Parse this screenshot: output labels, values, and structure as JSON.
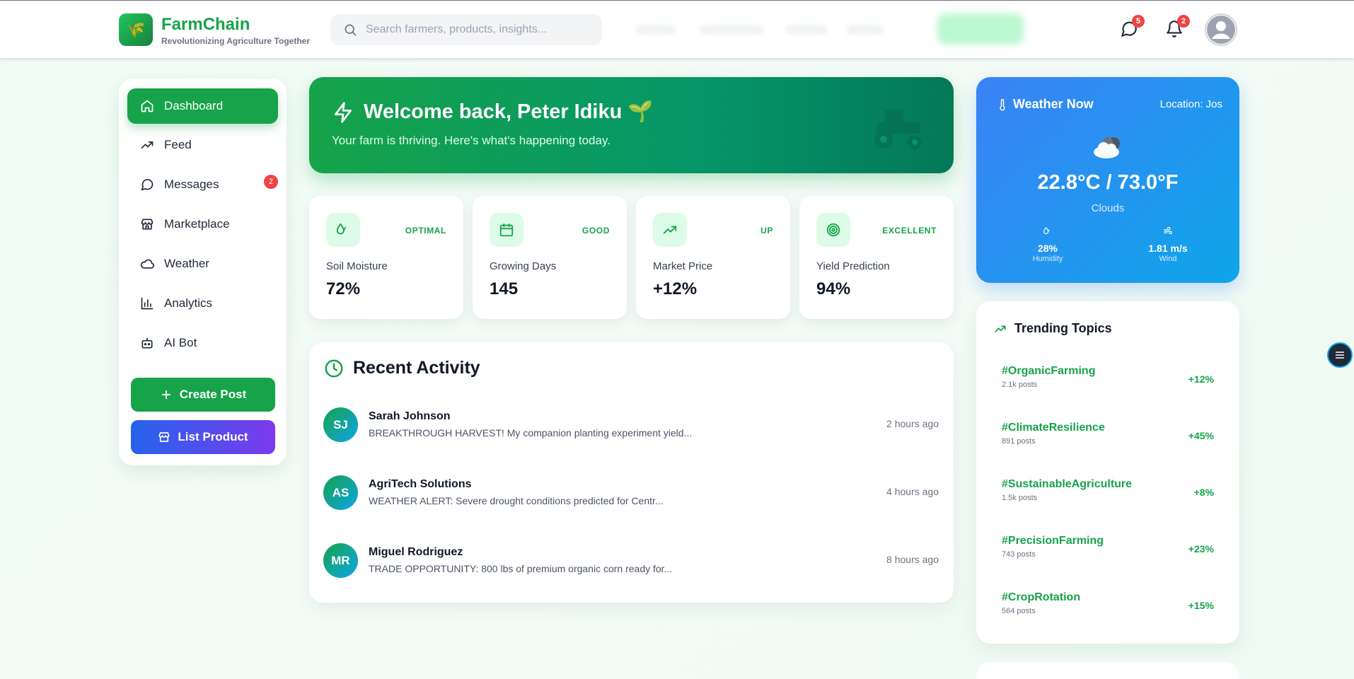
{
  "header": {
    "brand_name": "FarmChain",
    "brand_tagline": "Revolutionizing Agriculture Together",
    "search_placeholder": "Search farmers, products, insights...",
    "messages_badge": "5",
    "notifications_badge": "2"
  },
  "sidebar": {
    "items": [
      {
        "label": "Dashboard",
        "icon": "home-icon",
        "active": true
      },
      {
        "label": "Feed",
        "icon": "trending-up-icon"
      },
      {
        "label": "Messages",
        "icon": "message-circle-icon",
        "badge": "2"
      },
      {
        "label": "Marketplace",
        "icon": "store-icon"
      },
      {
        "label": "Weather",
        "icon": "cloud-icon"
      },
      {
        "label": "Analytics",
        "icon": "bar-chart-icon"
      },
      {
        "label": "AI Bot",
        "icon": "bot-icon"
      }
    ],
    "create_post_label": "Create Post",
    "list_product_label": "List Product"
  },
  "welcome": {
    "title": "Welcome back, Peter Idiku 🌱",
    "subtitle": "Your farm is thriving. Here's what's happening today."
  },
  "stats": [
    {
      "label": "Soil Moisture",
      "value": "72%",
      "status": "OPTIMAL",
      "icon": "droplets-icon"
    },
    {
      "label": "Growing Days",
      "value": "145",
      "status": "GOOD",
      "icon": "calendar-icon"
    },
    {
      "label": "Market Price",
      "value": "+12%",
      "status": "UP",
      "icon": "trending-up-icon"
    },
    {
      "label": "Yield Prediction",
      "value": "94%",
      "status": "EXCELLENT",
      "icon": "target-icon"
    }
  ],
  "activity": {
    "title": "Recent Activity",
    "items": [
      {
        "initials": "SJ",
        "name": "Sarah Johnson",
        "text": "BREAKTHROUGH HARVEST! My companion planting experiment yield...",
        "time": "2 hours ago"
      },
      {
        "initials": "AS",
        "name": "AgriTech Solutions",
        "text": "WEATHER ALERT: Severe drought conditions predicted for Centr...",
        "time": "4 hours ago"
      },
      {
        "initials": "MR",
        "name": "Miguel Rodriguez",
        "text": "TRADE OPPORTUNITY: 800 lbs of premium organic corn ready for...",
        "time": "8 hours ago"
      }
    ]
  },
  "weather": {
    "title": "Weather Now",
    "location": "Location: Jos",
    "temperature": "22.8°C / 73.0°F",
    "condition": "Clouds",
    "humidity_value": "28%",
    "humidity_label": "Humidity",
    "wind_value": "1.81 m/s",
    "wind_label": "Wind"
  },
  "trending": {
    "title": "Trending Topics",
    "items": [
      {
        "tag": "#OrganicFarming",
        "count": "2.1k posts",
        "change": "+12%"
      },
      {
        "tag": "#ClimateResilience",
        "count": "891 posts",
        "change": "+45%"
      },
      {
        "tag": "#SustainableAgriculture",
        "count": "1.5k posts",
        "change": "+8%"
      },
      {
        "tag": "#PrecisionFarming",
        "count": "743 posts",
        "change": "+23%"
      },
      {
        "tag": "#CropRotation",
        "count": "564 posts",
        "change": "+15%"
      }
    ]
  },
  "colors": {
    "brand": "#16a34a",
    "brand_dark": "#047857",
    "weather_blue": "#3b82f6",
    "badge_red": "#ef4444",
    "list_product_gradient_start": "#2563eb",
    "list_product_gradient_end": "#7c3aed"
  }
}
